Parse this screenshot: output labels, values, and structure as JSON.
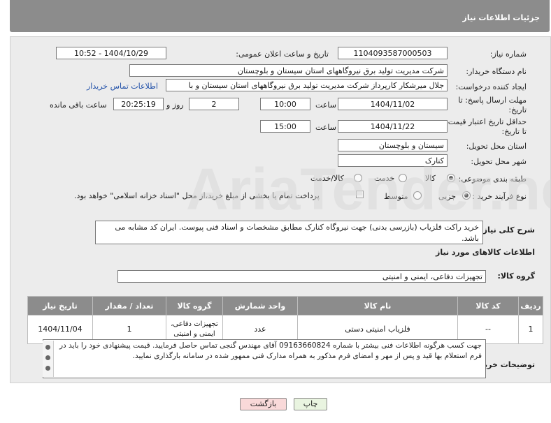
{
  "header": {
    "title": "جزئیات اطلاعات نیاز"
  },
  "form": {
    "need_number_label": "شماره نیاز:",
    "need_number": "1104093587000503",
    "announce_label": "تاریخ و ساعت اعلان عمومی:",
    "announce_value": "1404/10/29 - 10:52",
    "buyer_org_label": "نام دستگاه خریدار:",
    "buyer_org": "شرکت مدیریت تولید برق نیروگاههای استان سیستان و بلوچستان",
    "creator_label": "ایجاد کننده درخواست:",
    "creator": "جلال میرشکار کارپرداز شرکت مدیریت تولید برق نیروگاههای استان سیستان و با",
    "contact_link": "اطلاعات تماس خریدار",
    "deadline_label_1": "مهلت ارسال پاسخ: تا",
    "deadline_label_2": "تاریخ:",
    "deadline_date": "1404/11/02",
    "time_label": "ساعت",
    "deadline_time": "10:00",
    "days_value": "2",
    "days_label": "روز و",
    "remaining_value": "20:25:19",
    "remaining_label": "ساعت باقی مانده",
    "validity_label_1": "حداقل تاریخ اعتبار قیمت:",
    "validity_label_2": "تا تاریخ:",
    "validity_date": "1404/11/22",
    "validity_time": "15:00",
    "province_label": "استان محل تحویل:",
    "province": "سیستان و بلوچستان",
    "city_label": "شهر محل تحویل:",
    "city": "کنارک",
    "category_label": "طبقه بندی موضوعی:",
    "category_options": [
      "کالا",
      "خدمت",
      "کالا/خدمت"
    ],
    "category_selected": "کالا",
    "process_label": "نوع فرآیند خرید :",
    "process_options": [
      "جزیی",
      "متوسط"
    ],
    "process_selected": "جزیی",
    "payment_note": "پرداخت تمام یا بخشی از مبلغ خرید،از محل \"اسناد خزانه اسلامی\" خواهد بود."
  },
  "general_desc": {
    "label": "شرح کلی نیاز:",
    "text": "خرید راکت فلزیاب (بازرسی بدنی) جهت نیروگاه کنارک مطابق مشخصات و اسناد فنی پیوست. ایران کد مشابه می باشد."
  },
  "goods": {
    "section_title": "اطلاعات کالاهای مورد نیاز",
    "group_label": "گروه کالا:",
    "group_value": "تجهیزات دفاعی، ایمنی و امنیتی",
    "columns": [
      "ردیف",
      "کد کالا",
      "نام کالا",
      "واحد شمارش",
      "گروه کالا",
      "تعداد / مقدار",
      "تاریخ نیاز"
    ],
    "rows": [
      {
        "row": "1",
        "code": "--",
        "name": "فلزیاب امنیتی دستی",
        "unit": "عدد",
        "group": "تجهیزات دفاعی، ایمنی و امنیتی",
        "qty": "1",
        "date": "1404/11/04"
      }
    ]
  },
  "buyer_notes": {
    "label": "توضیحات خریدار:",
    "text": "جهت کسب هرگونه اطلاعات فنی بیشتر با شماره 09163660824 آقای مهندس گنجی تماس حاصل فرمایید. قیمت پیشنهادی خود را باید در فرم استعلام بها قید و پس از مهر و امضای فرم مذکور به همراه مدارک فنی ممهور شده در سامانه بارگذاری نمایید."
  },
  "buttons": {
    "print": "چاپ",
    "back": "بازگشت"
  },
  "watermark": "AriaTender.neT",
  "colors": {
    "header_bg": "#8c8c8c",
    "panel_bg": "#ececec",
    "link": "#1f4fa8",
    "back_btn": "#f9d9d9",
    "print_btn": "#e9f4e0"
  }
}
